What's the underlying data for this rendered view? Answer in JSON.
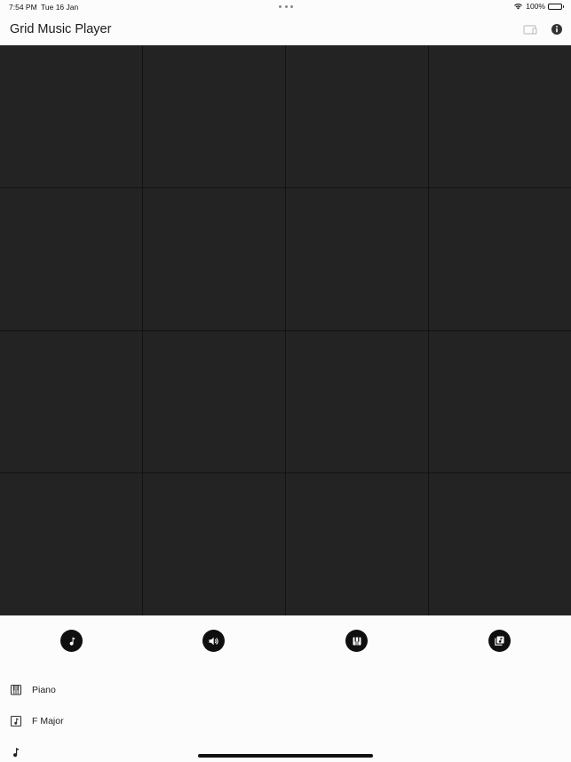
{
  "status_bar": {
    "time": "7:54 PM",
    "date": "Tue 16 Jan",
    "battery": "100%",
    "icons": [
      "wifi-icon",
      "battery-icon"
    ]
  },
  "app_bar": {
    "title": "Grid Music Player",
    "icons": [
      "cast-icon",
      "info-icon"
    ]
  },
  "grid": {
    "rows": 4,
    "columns": 4,
    "cell_color": "#232323",
    "line_color": "#121212"
  },
  "toolbar": {
    "buttons": [
      {
        "icon": "music-note-icon"
      },
      {
        "icon": "volume-icon"
      },
      {
        "icon": "piano-icon"
      },
      {
        "icon": "music-library-icon"
      }
    ]
  },
  "settings": {
    "instrument": {
      "icon": "piano-keys-icon",
      "label": "Piano"
    },
    "key": {
      "icon": "key-signature-icon",
      "label": "F Major"
    },
    "note": {
      "icon": "music-note-icon"
    }
  },
  "colors": {
    "background": "#fcfcfc",
    "grid_cell": "#232323",
    "button": "#0f0f0f"
  }
}
